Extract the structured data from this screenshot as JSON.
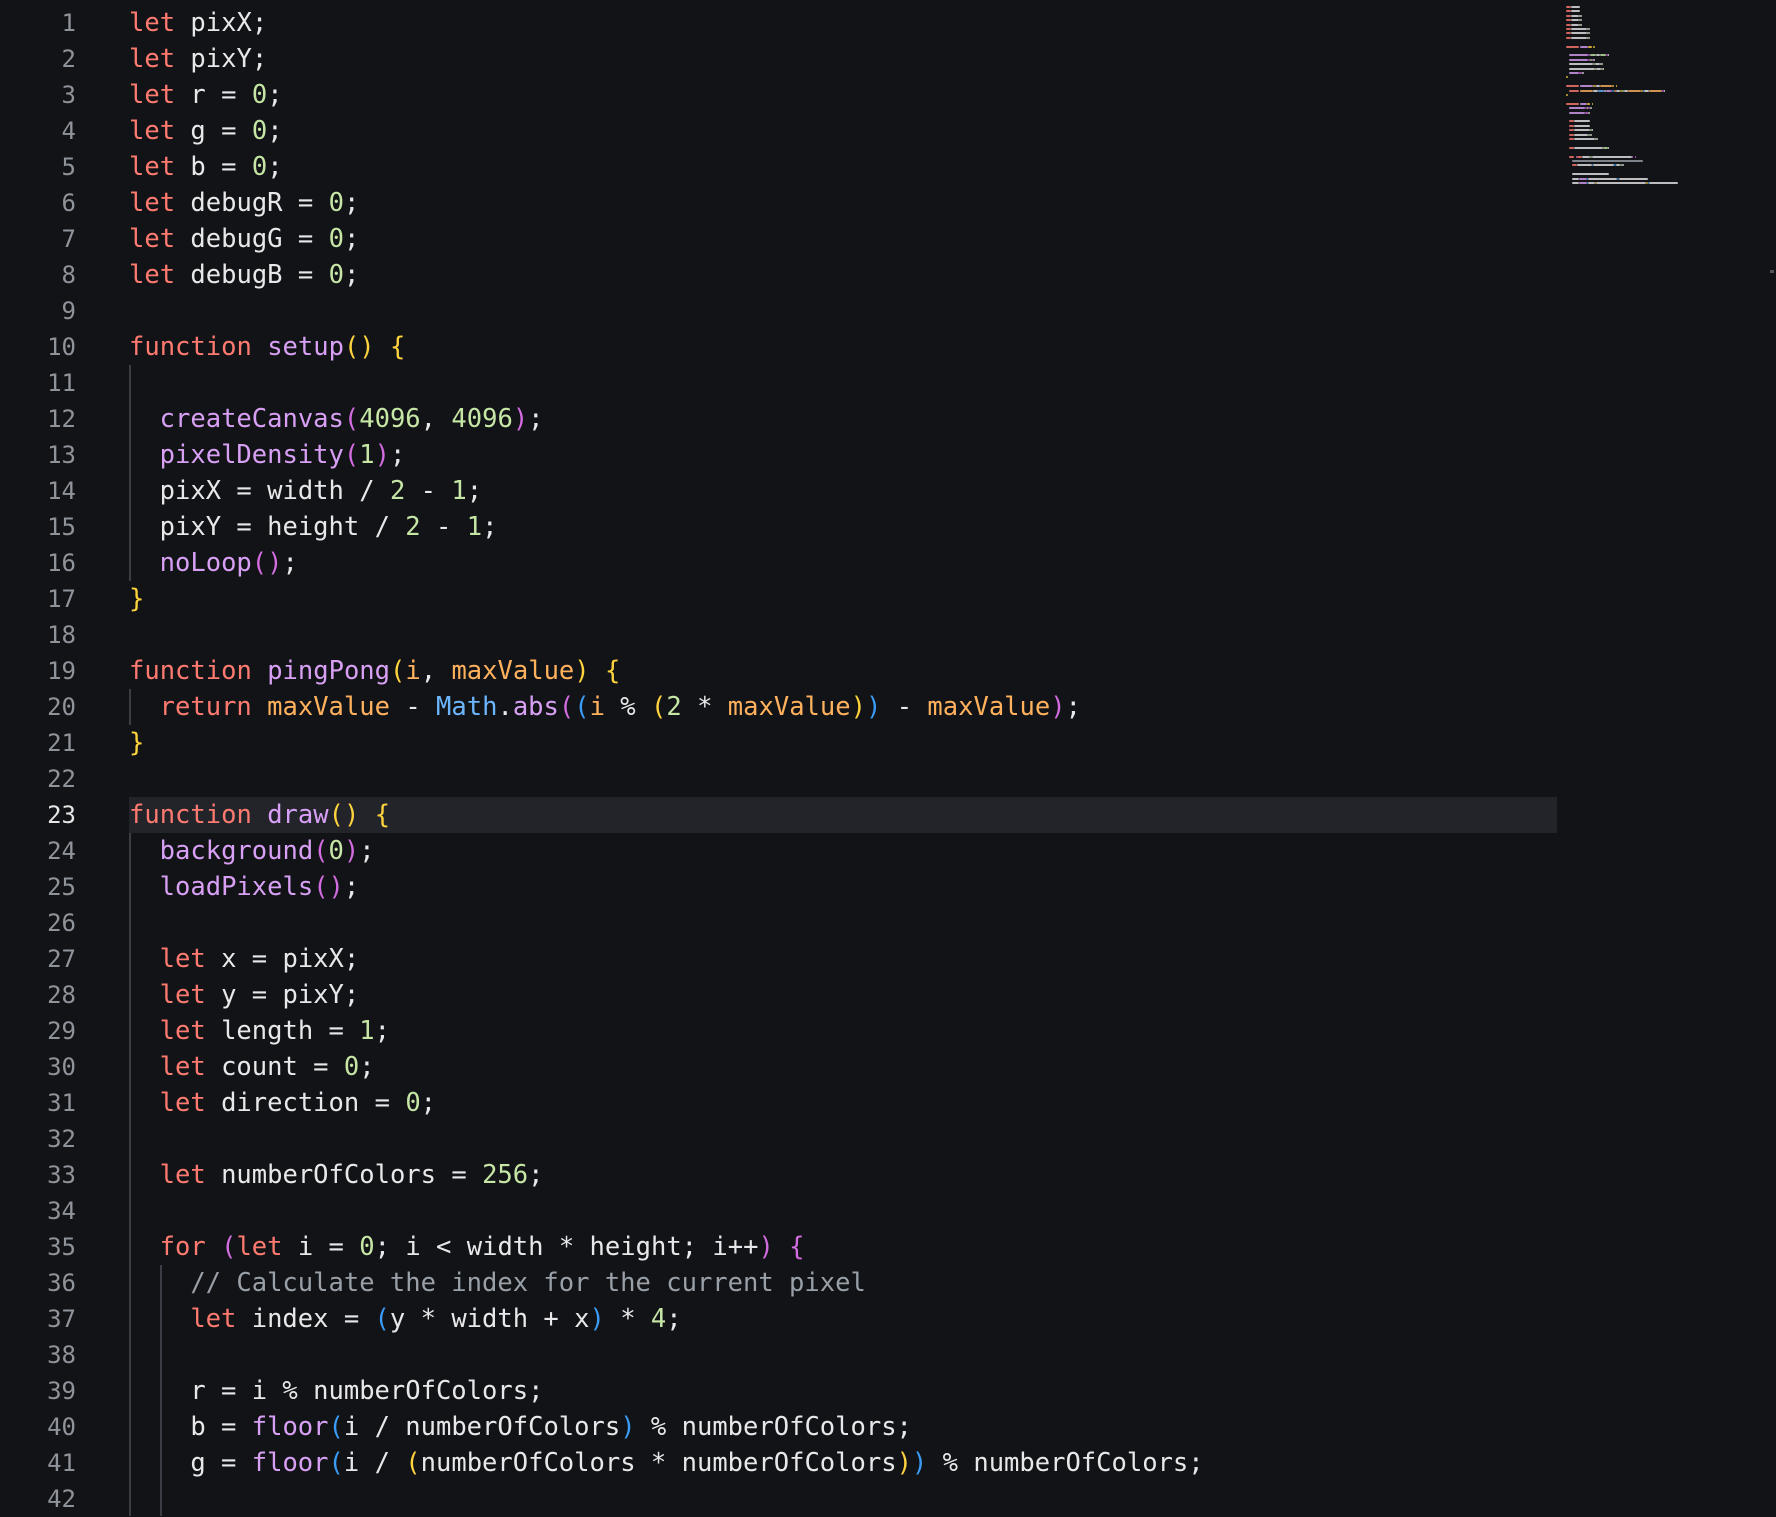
{
  "editor": {
    "active_line": 23,
    "colors": {
      "background": "#121316",
      "keyword": "#ff7a70",
      "function": "#d8a0f5",
      "number": "#c6e6a6",
      "parameter": "#ffb15e",
      "object": "#6cb6ff",
      "comment": "#9aa0a8",
      "text": "#e8e8ea",
      "bracket_level1": "#ffd33d",
      "bracket_level2": "#d36ce0",
      "bracket_level3": "#3a9cf7"
    },
    "lines": [
      {
        "n": "1",
        "indent": 0,
        "tokens": [
          [
            "kw",
            "let"
          ],
          [
            "id",
            " pixX;"
          ]
        ]
      },
      {
        "n": "2",
        "indent": 0,
        "tokens": [
          [
            "kw",
            "let"
          ],
          [
            "id",
            " pixY;"
          ]
        ]
      },
      {
        "n": "3",
        "indent": 0,
        "tokens": [
          [
            "kw",
            "let"
          ],
          [
            "id",
            " r = "
          ],
          [
            "num",
            "0"
          ],
          [
            "id",
            ";"
          ]
        ]
      },
      {
        "n": "4",
        "indent": 0,
        "tokens": [
          [
            "kw",
            "let"
          ],
          [
            "id",
            " g = "
          ],
          [
            "num",
            "0"
          ],
          [
            "id",
            ";"
          ]
        ]
      },
      {
        "n": "5",
        "indent": 0,
        "tokens": [
          [
            "kw",
            "let"
          ],
          [
            "id",
            " b = "
          ],
          [
            "num",
            "0"
          ],
          [
            "id",
            ";"
          ]
        ]
      },
      {
        "n": "6",
        "indent": 0,
        "tokens": [
          [
            "kw",
            "let"
          ],
          [
            "id",
            " debugR = "
          ],
          [
            "num",
            "0"
          ],
          [
            "id",
            ";"
          ]
        ]
      },
      {
        "n": "7",
        "indent": 0,
        "tokens": [
          [
            "kw",
            "let"
          ],
          [
            "id",
            " debugG = "
          ],
          [
            "num",
            "0"
          ],
          [
            "id",
            ";"
          ]
        ]
      },
      {
        "n": "8",
        "indent": 0,
        "tokens": [
          [
            "kw",
            "let"
          ],
          [
            "id",
            " debugB = "
          ],
          [
            "num",
            "0"
          ],
          [
            "id",
            ";"
          ]
        ]
      },
      {
        "n": "9",
        "indent": 0,
        "tokens": []
      },
      {
        "n": "10",
        "indent": 0,
        "tokens": [
          [
            "kw",
            "function"
          ],
          [
            "id",
            " "
          ],
          [
            "fn",
            "setup"
          ],
          [
            "b1",
            "()"
          ],
          [
            "id",
            " "
          ],
          [
            "b1",
            "{"
          ]
        ]
      },
      {
        "n": "11",
        "indent": 1,
        "tokens": []
      },
      {
        "n": "12",
        "indent": 1,
        "tokens": [
          [
            "fn",
            "createCanvas"
          ],
          [
            "b2",
            "("
          ],
          [
            "num",
            "4096"
          ],
          [
            "id",
            ", "
          ],
          [
            "num",
            "4096"
          ],
          [
            "b2",
            ")"
          ],
          [
            "id",
            ";"
          ]
        ]
      },
      {
        "n": "13",
        "indent": 1,
        "tokens": [
          [
            "fn",
            "pixelDensity"
          ],
          [
            "b2",
            "("
          ],
          [
            "num",
            "1"
          ],
          [
            "b2",
            ")"
          ],
          [
            "id",
            ";"
          ]
        ]
      },
      {
        "n": "14",
        "indent": 1,
        "tokens": [
          [
            "id",
            "pixX = width / "
          ],
          [
            "num",
            "2"
          ],
          [
            "id",
            " - "
          ],
          [
            "num",
            "1"
          ],
          [
            "id",
            ";"
          ]
        ]
      },
      {
        "n": "15",
        "indent": 1,
        "tokens": [
          [
            "id",
            "pixY = height / "
          ],
          [
            "num",
            "2"
          ],
          [
            "id",
            " - "
          ],
          [
            "num",
            "1"
          ],
          [
            "id",
            ";"
          ]
        ]
      },
      {
        "n": "16",
        "indent": 1,
        "tokens": [
          [
            "fn",
            "noLoop"
          ],
          [
            "b2",
            "()"
          ],
          [
            "id",
            ";"
          ]
        ]
      },
      {
        "n": "17",
        "indent": 0,
        "tokens": [
          [
            "b1",
            "}"
          ]
        ]
      },
      {
        "n": "18",
        "indent": 0,
        "tokens": []
      },
      {
        "n": "19",
        "indent": 0,
        "tokens": [
          [
            "kw",
            "function"
          ],
          [
            "id",
            " "
          ],
          [
            "fn",
            "pingPong"
          ],
          [
            "b1",
            "("
          ],
          [
            "param",
            "i"
          ],
          [
            "id",
            ", "
          ],
          [
            "param",
            "maxValue"
          ],
          [
            "b1",
            ")"
          ],
          [
            "id",
            " "
          ],
          [
            "b1",
            "{"
          ]
        ]
      },
      {
        "n": "20",
        "indent": 1,
        "tokens": [
          [
            "kw",
            "return"
          ],
          [
            "id",
            " "
          ],
          [
            "param",
            "maxValue"
          ],
          [
            "id",
            " - "
          ],
          [
            "obj",
            "Math"
          ],
          [
            "id",
            "."
          ],
          [
            "fn",
            "abs"
          ],
          [
            "b2",
            "("
          ],
          [
            "b3",
            "("
          ],
          [
            "param",
            "i"
          ],
          [
            "id",
            " % "
          ],
          [
            "b1",
            "("
          ],
          [
            "num",
            "2"
          ],
          [
            "id",
            " * "
          ],
          [
            "param",
            "maxValue"
          ],
          [
            "b1",
            ")"
          ],
          [
            "b3",
            ")"
          ],
          [
            "id",
            " - "
          ],
          [
            "param",
            "maxValue"
          ],
          [
            "b2",
            ")"
          ],
          [
            "id",
            ";"
          ]
        ]
      },
      {
        "n": "21",
        "indent": 0,
        "tokens": [
          [
            "b1",
            "}"
          ]
        ]
      },
      {
        "n": "22",
        "indent": 0,
        "tokens": []
      },
      {
        "n": "23",
        "indent": 0,
        "tokens": [
          [
            "kw",
            "function"
          ],
          [
            "id",
            " "
          ],
          [
            "fn",
            "draw"
          ],
          [
            "b1",
            "()"
          ],
          [
            "id",
            " "
          ],
          [
            "b1",
            "{"
          ]
        ]
      },
      {
        "n": "24",
        "indent": 1,
        "tokens": [
          [
            "fn",
            "background"
          ],
          [
            "b2",
            "("
          ],
          [
            "num",
            "0"
          ],
          [
            "b2",
            ")"
          ],
          [
            "id",
            ";"
          ]
        ]
      },
      {
        "n": "25",
        "indent": 1,
        "tokens": [
          [
            "fn",
            "loadPixels"
          ],
          [
            "b2",
            "()"
          ],
          [
            "id",
            ";"
          ]
        ]
      },
      {
        "n": "26",
        "indent": 1,
        "tokens": []
      },
      {
        "n": "27",
        "indent": 1,
        "tokens": [
          [
            "kw",
            "let"
          ],
          [
            "id",
            " x = pixX;"
          ]
        ]
      },
      {
        "n": "28",
        "indent": 1,
        "tokens": [
          [
            "kw",
            "let"
          ],
          [
            "id",
            " y = pixY;"
          ]
        ]
      },
      {
        "n": "29",
        "indent": 1,
        "tokens": [
          [
            "kw",
            "let"
          ],
          [
            "id",
            " length = "
          ],
          [
            "num",
            "1"
          ],
          [
            "id",
            ";"
          ]
        ]
      },
      {
        "n": "30",
        "indent": 1,
        "tokens": [
          [
            "kw",
            "let"
          ],
          [
            "id",
            " count = "
          ],
          [
            "num",
            "0"
          ],
          [
            "id",
            ";"
          ]
        ]
      },
      {
        "n": "31",
        "indent": 1,
        "tokens": [
          [
            "kw",
            "let"
          ],
          [
            "id",
            " direction = "
          ],
          [
            "num",
            "0"
          ],
          [
            "id",
            ";"
          ]
        ]
      },
      {
        "n": "32",
        "indent": 1,
        "tokens": []
      },
      {
        "n": "33",
        "indent": 1,
        "tokens": [
          [
            "kw",
            "let"
          ],
          [
            "id",
            " numberOfColors = "
          ],
          [
            "num",
            "256"
          ],
          [
            "id",
            ";"
          ]
        ]
      },
      {
        "n": "34",
        "indent": 1,
        "tokens": []
      },
      {
        "n": "35",
        "indent": 1,
        "tokens": [
          [
            "kw",
            "for"
          ],
          [
            "id",
            " "
          ],
          [
            "b2",
            "("
          ],
          [
            "kw",
            "let"
          ],
          [
            "id",
            " i = "
          ],
          [
            "num",
            "0"
          ],
          [
            "id",
            "; i < width * height; i++"
          ],
          [
            "b2",
            ")"
          ],
          [
            "id",
            " "
          ],
          [
            "b2",
            "{"
          ]
        ]
      },
      {
        "n": "36",
        "indent": 2,
        "tokens": [
          [
            "cm",
            "// Calculate the index for the current pixel"
          ]
        ]
      },
      {
        "n": "37",
        "indent": 2,
        "tokens": [
          [
            "kw",
            "let"
          ],
          [
            "id",
            " index = "
          ],
          [
            "b3",
            "("
          ],
          [
            "id",
            "y * width + x"
          ],
          [
            "b3",
            ")"
          ],
          [
            "id",
            " * "
          ],
          [
            "num",
            "4"
          ],
          [
            "id",
            ";"
          ]
        ]
      },
      {
        "n": "38",
        "indent": 2,
        "tokens": []
      },
      {
        "n": "39",
        "indent": 2,
        "tokens": [
          [
            "id",
            "r = i % numberOfColors;"
          ]
        ]
      },
      {
        "n": "40",
        "indent": 2,
        "tokens": [
          [
            "id",
            "b = "
          ],
          [
            "fn",
            "floor"
          ],
          [
            "b3",
            "("
          ],
          [
            "id",
            "i / numberOfColors"
          ],
          [
            "b3",
            ")"
          ],
          [
            "id",
            " % numberOfColors;"
          ]
        ]
      },
      {
        "n": "41",
        "indent": 2,
        "tokens": [
          [
            "id",
            "g = "
          ],
          [
            "fn",
            "floor"
          ],
          [
            "b3",
            "("
          ],
          [
            "id",
            "i / "
          ],
          [
            "b1",
            "("
          ],
          [
            "id",
            "numberOfColors * numberOfColors"
          ],
          [
            "b1",
            ")"
          ],
          [
            "b3",
            ")"
          ],
          [
            "id",
            " % numberOfColors;"
          ]
        ]
      },
      {
        "n": "42",
        "indent": 2,
        "tokens": []
      }
    ]
  }
}
